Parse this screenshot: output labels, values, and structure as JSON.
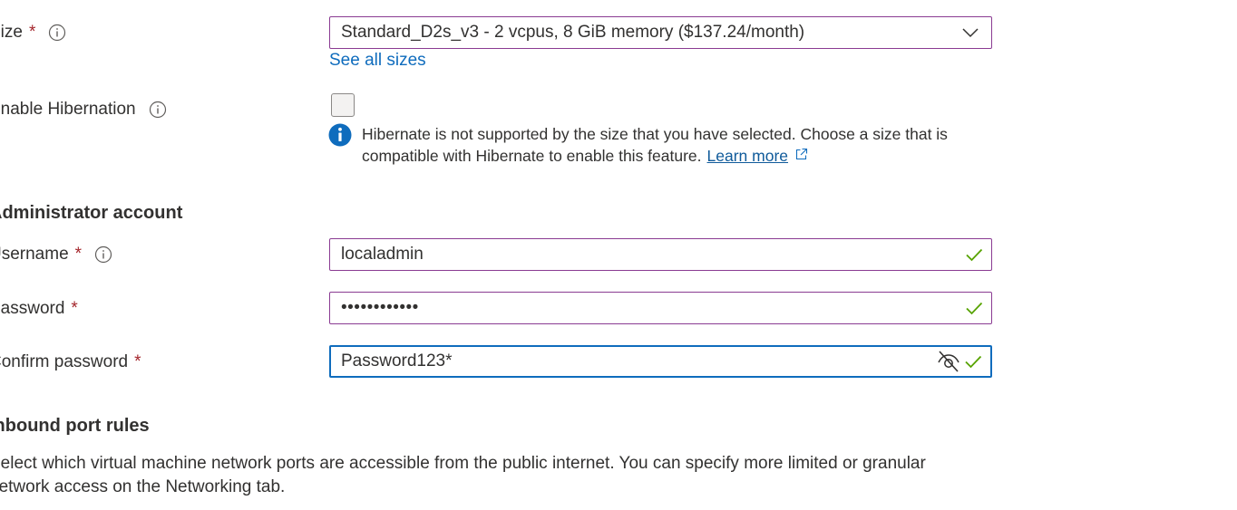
{
  "size": {
    "label": "Size",
    "required_mark": "*",
    "selected": "Standard_D2s_v3 - 2 vcpus, 8 GiB memory ($137.24/month)",
    "see_all_link": "See all sizes"
  },
  "hibernation": {
    "label": "Enable Hibernation",
    "checked": false,
    "message": "Hibernate is not supported by the size that you have selected. Choose a size that is compatible with Hibernate to enable this feature.",
    "learn_more": "Learn more"
  },
  "admin_account": {
    "heading": "Administrator account",
    "username": {
      "label": "Username",
      "required_mark": "*",
      "value": "localadmin"
    },
    "password": {
      "label": "Password",
      "required_mark": "*",
      "value": "••••••••••••"
    },
    "confirm_password": {
      "label": "Confirm password",
      "required_mark": "*",
      "value": "Password123*"
    }
  },
  "inbound": {
    "heading": "Inbound port rules",
    "description": "Select which virtual machine network ports are accessible from the public internet. You can specify more limited or granular network access on the Networking tab."
  },
  "colors": {
    "accent": "#0f6cbd",
    "field_border": "#8a3b92",
    "required": "#a4262c",
    "valid": "#57a300"
  }
}
